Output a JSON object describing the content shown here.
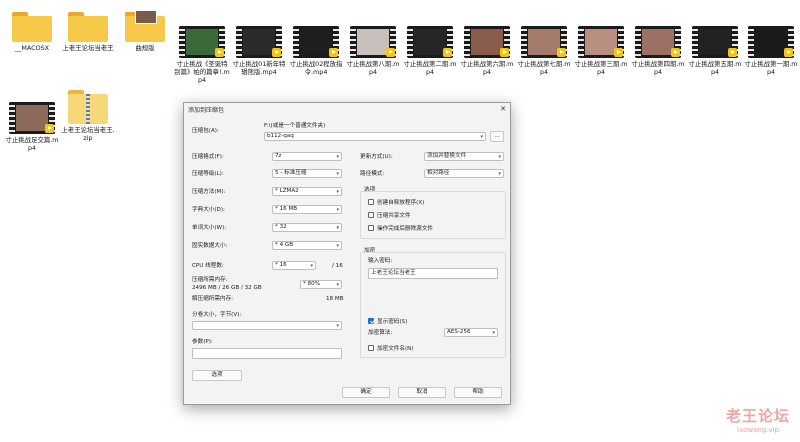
{
  "desktop": {
    "items": [
      {
        "name": "__MACOSX",
        "type": "folder"
      },
      {
        "name": "上老王论坛当老王",
        "type": "folder"
      },
      {
        "name": "曲规版",
        "type": "folder-photo"
      },
      {
        "name": "寸止挑战《圣诞特别篇》帕的篇章!.mp4",
        "type": "video"
      },
      {
        "name": "寸止挑战01新年特辑熊版.mp4",
        "type": "video"
      },
      {
        "name": "寸止挑战02程放指令.mp4",
        "type": "video"
      },
      {
        "name": "寸止挑战第八期.mp4",
        "type": "video"
      },
      {
        "name": "寸止挑战第二期.mp4",
        "type": "video"
      },
      {
        "name": "寸止挑战第六期.mp4",
        "type": "video"
      },
      {
        "name": "寸止挑战第七期.mp4",
        "type": "video"
      },
      {
        "name": "寸止挑战第三期.mp4",
        "type": "video"
      },
      {
        "name": "寸止挑战第四期.mp4",
        "type": "video"
      },
      {
        "name": "寸止挑战第五期.mp4",
        "type": "video"
      },
      {
        "name": "寸止挑战第一期.mp4",
        "type": "video"
      },
      {
        "name": "寸止挑战足交篇.mp4",
        "type": "video"
      },
      {
        "name": "上老王论坛当老王.zip",
        "type": "zip"
      }
    ]
  },
  "dialog": {
    "title": "添加到压缩包",
    "close_label": "✕",
    "archive_label": "压缩包(A):",
    "archive_hint": "F:\\(或是一个普通文件夹)",
    "archive_value": "b112-qaq",
    "browse_label": "...",
    "format_label": "压缩格式(F):",
    "format_value": "7z",
    "level_label": "压缩等级(L):",
    "level_value": "5 - 标准压缩",
    "method_label": "压缩方法(M):",
    "method_value": "* LZMA2",
    "dict_label": "字典大小(D):",
    "dict_value": "* 16 MB",
    "word_label": "单词大小(W):",
    "word_value": "* 32",
    "solid_label": "固实数据大小:",
    "solid_value": "* 4 GB",
    "threads_label": "CPU 线程数:",
    "threads_value": "* 16",
    "threads_total": "/ 16",
    "mem_label": "压缩所需内存:",
    "mem_detail": "2496 MB / 26 GB / 32 GB",
    "mem_value": "* 80%",
    "decomp_label": "解压缩所需内存:",
    "decomp_value": "18 MB",
    "split_label": "分卷大小，字节(V):",
    "split_value": "",
    "params_label": "参数(P):",
    "params_value": "",
    "options_button": "选项",
    "update_label": "更新方式(U):",
    "update_value": "添加并替换文件",
    "path_label": "路径模式:",
    "path_value": "相对路径",
    "options_title": "选项",
    "opt_sfx": "创建自释放程序(X)",
    "opt_shared": "压缩共享文件",
    "opt_delete": "操作完成后删除源文件",
    "encrypt_title": "加密",
    "password_label": "输入密码:",
    "password_value": "上老王论坛当老王",
    "show_password": "显示密码(S)",
    "enc_method_label": "加密算法:",
    "enc_method_value": "AES-256",
    "encrypt_names": "加密文件名(N)",
    "ok_button": "确定",
    "cancel_button": "取消",
    "help_button": "帮助"
  },
  "watermark": {
    "title": "老王论坛",
    "url": "laowang.vip"
  },
  "colors": {
    "folder": "#f7c948",
    "folder_back": "#e8a92c",
    "accent": "#1f6fc5",
    "watermark": "#f2a3a3"
  }
}
